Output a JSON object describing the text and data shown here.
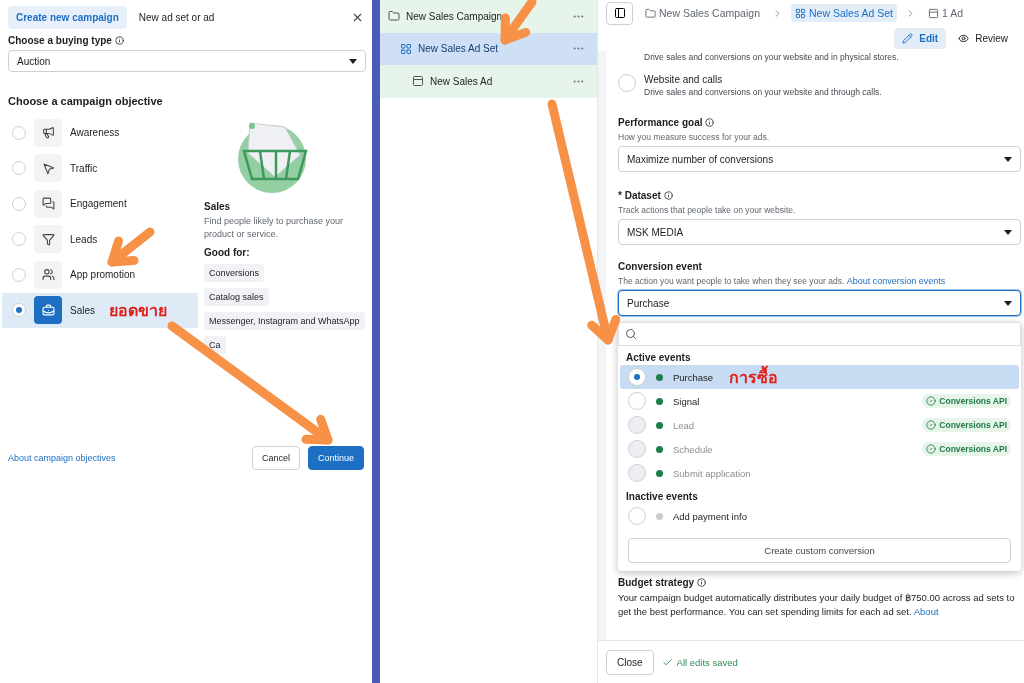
{
  "left_panel": {
    "tabs": [
      {
        "label": "Create new campaign",
        "selected": true
      },
      {
        "label": "New ad set or ad",
        "selected": false
      }
    ],
    "buying_type": {
      "label": "Choose a buying type",
      "value": "Auction"
    },
    "objective_heading": "Choose a campaign objective",
    "objectives": [
      {
        "label": "Awareness",
        "kind": "megaphone",
        "selected": false
      },
      {
        "label": "Traffic",
        "kind": "pointer",
        "selected": false
      },
      {
        "label": "Engagement",
        "kind": "chat",
        "selected": false
      },
      {
        "label": "Leads",
        "kind": "filter",
        "selected": false
      },
      {
        "label": "App promotion",
        "kind": "people",
        "selected": false
      },
      {
        "label": "Sales",
        "kind": "bag",
        "selected": true,
        "annotation": "ยอดขาย"
      }
    ],
    "detail": {
      "title": "Sales",
      "description": "Find people likely to purchase your product or service.",
      "good_for_label": "Good for:",
      "tags": [
        "Conversions",
        "Catalog sales",
        "Messenger, Instagram and WhatsApp",
        "Ca"
      ]
    },
    "footer": {
      "link": "About campaign objectives",
      "cancel": "Cancel",
      "continue": "Continue"
    }
  },
  "tree": [
    {
      "label": "New Sales Campaign",
      "kind": "campaign",
      "selected": false,
      "children": [
        {
          "label": "New Sales Ad Set",
          "kind": "adset",
          "selected": true,
          "children": [
            {
              "label": "New Sales Ad",
              "kind": "ad",
              "selected": false
            }
          ]
        }
      ]
    }
  ],
  "editor": {
    "breadcrumbs": [
      {
        "label": "New Sales Campaign",
        "kind": "campaign",
        "selected": false
      },
      {
        "label": "New Sales Ad Set",
        "kind": "adset",
        "selected": true
      },
      {
        "label": "1 Ad",
        "kind": "ad",
        "selected": false
      }
    ],
    "modes": [
      {
        "label": "Edit",
        "kind": "edit",
        "selected": true
      },
      {
        "label": "Review",
        "kind": "review",
        "selected": false
      }
    ],
    "cut_option_description": "Drive sales and conversions on your website and in physical stores.",
    "location_option": {
      "title": "Website and calls",
      "description": "Drive sales and conversions on your website and through calls.",
      "selected": false
    },
    "performance_goal": {
      "label": "Performance goal",
      "hint": "How you measure success for your ads.",
      "value": "Maximize number of conversions"
    },
    "dataset": {
      "required_mark": "*",
      "label": "Dataset",
      "hint": "Track actions that people take on your website.",
      "value": "MSK MEDIA"
    },
    "conversion_event": {
      "label": "Conversion event",
      "hint": "The action you want people to take when they see your ads.",
      "link": "About conversion events",
      "value": "Purchase"
    },
    "event_menu": {
      "groups": [
        {
          "title": "Active events",
          "events": [
            {
              "name": "Purchase",
              "selected": true,
              "disabled": false,
              "color": "#1e7b4a",
              "annotation": "การซื้อ"
            },
            {
              "name": "Signal",
              "selected": false,
              "disabled": false,
              "color": "#1e7b4a",
              "badge": "Conversions API"
            },
            {
              "name": "Lead",
              "selected": false,
              "disabled": true,
              "color": "#1e7b4a",
              "badge": "Conversions API"
            },
            {
              "name": "Schedule",
              "selected": false,
              "disabled": true,
              "color": "#1e7b4a",
              "badge": "Conversions API"
            },
            {
              "name": "Submit application",
              "selected": false,
              "disabled": true,
              "color": "#1e7b4a"
            }
          ]
        },
        {
          "title": "Inactive events",
          "events": [
            {
              "name": "Add payment info",
              "selected": false,
              "disabled": false,
              "color": "#c9ccd1"
            }
          ]
        }
      ],
      "create_button": "Create custom conversion"
    },
    "budget": {
      "title": "Budget strategy",
      "text": "Your campaign budget automatically distributes your daily budget of ฿750.00 across ad sets to get the best performance. You can set spending limits for each ad set.",
      "link": "About"
    },
    "footer": {
      "close": "Close",
      "status": "All edits saved"
    }
  }
}
